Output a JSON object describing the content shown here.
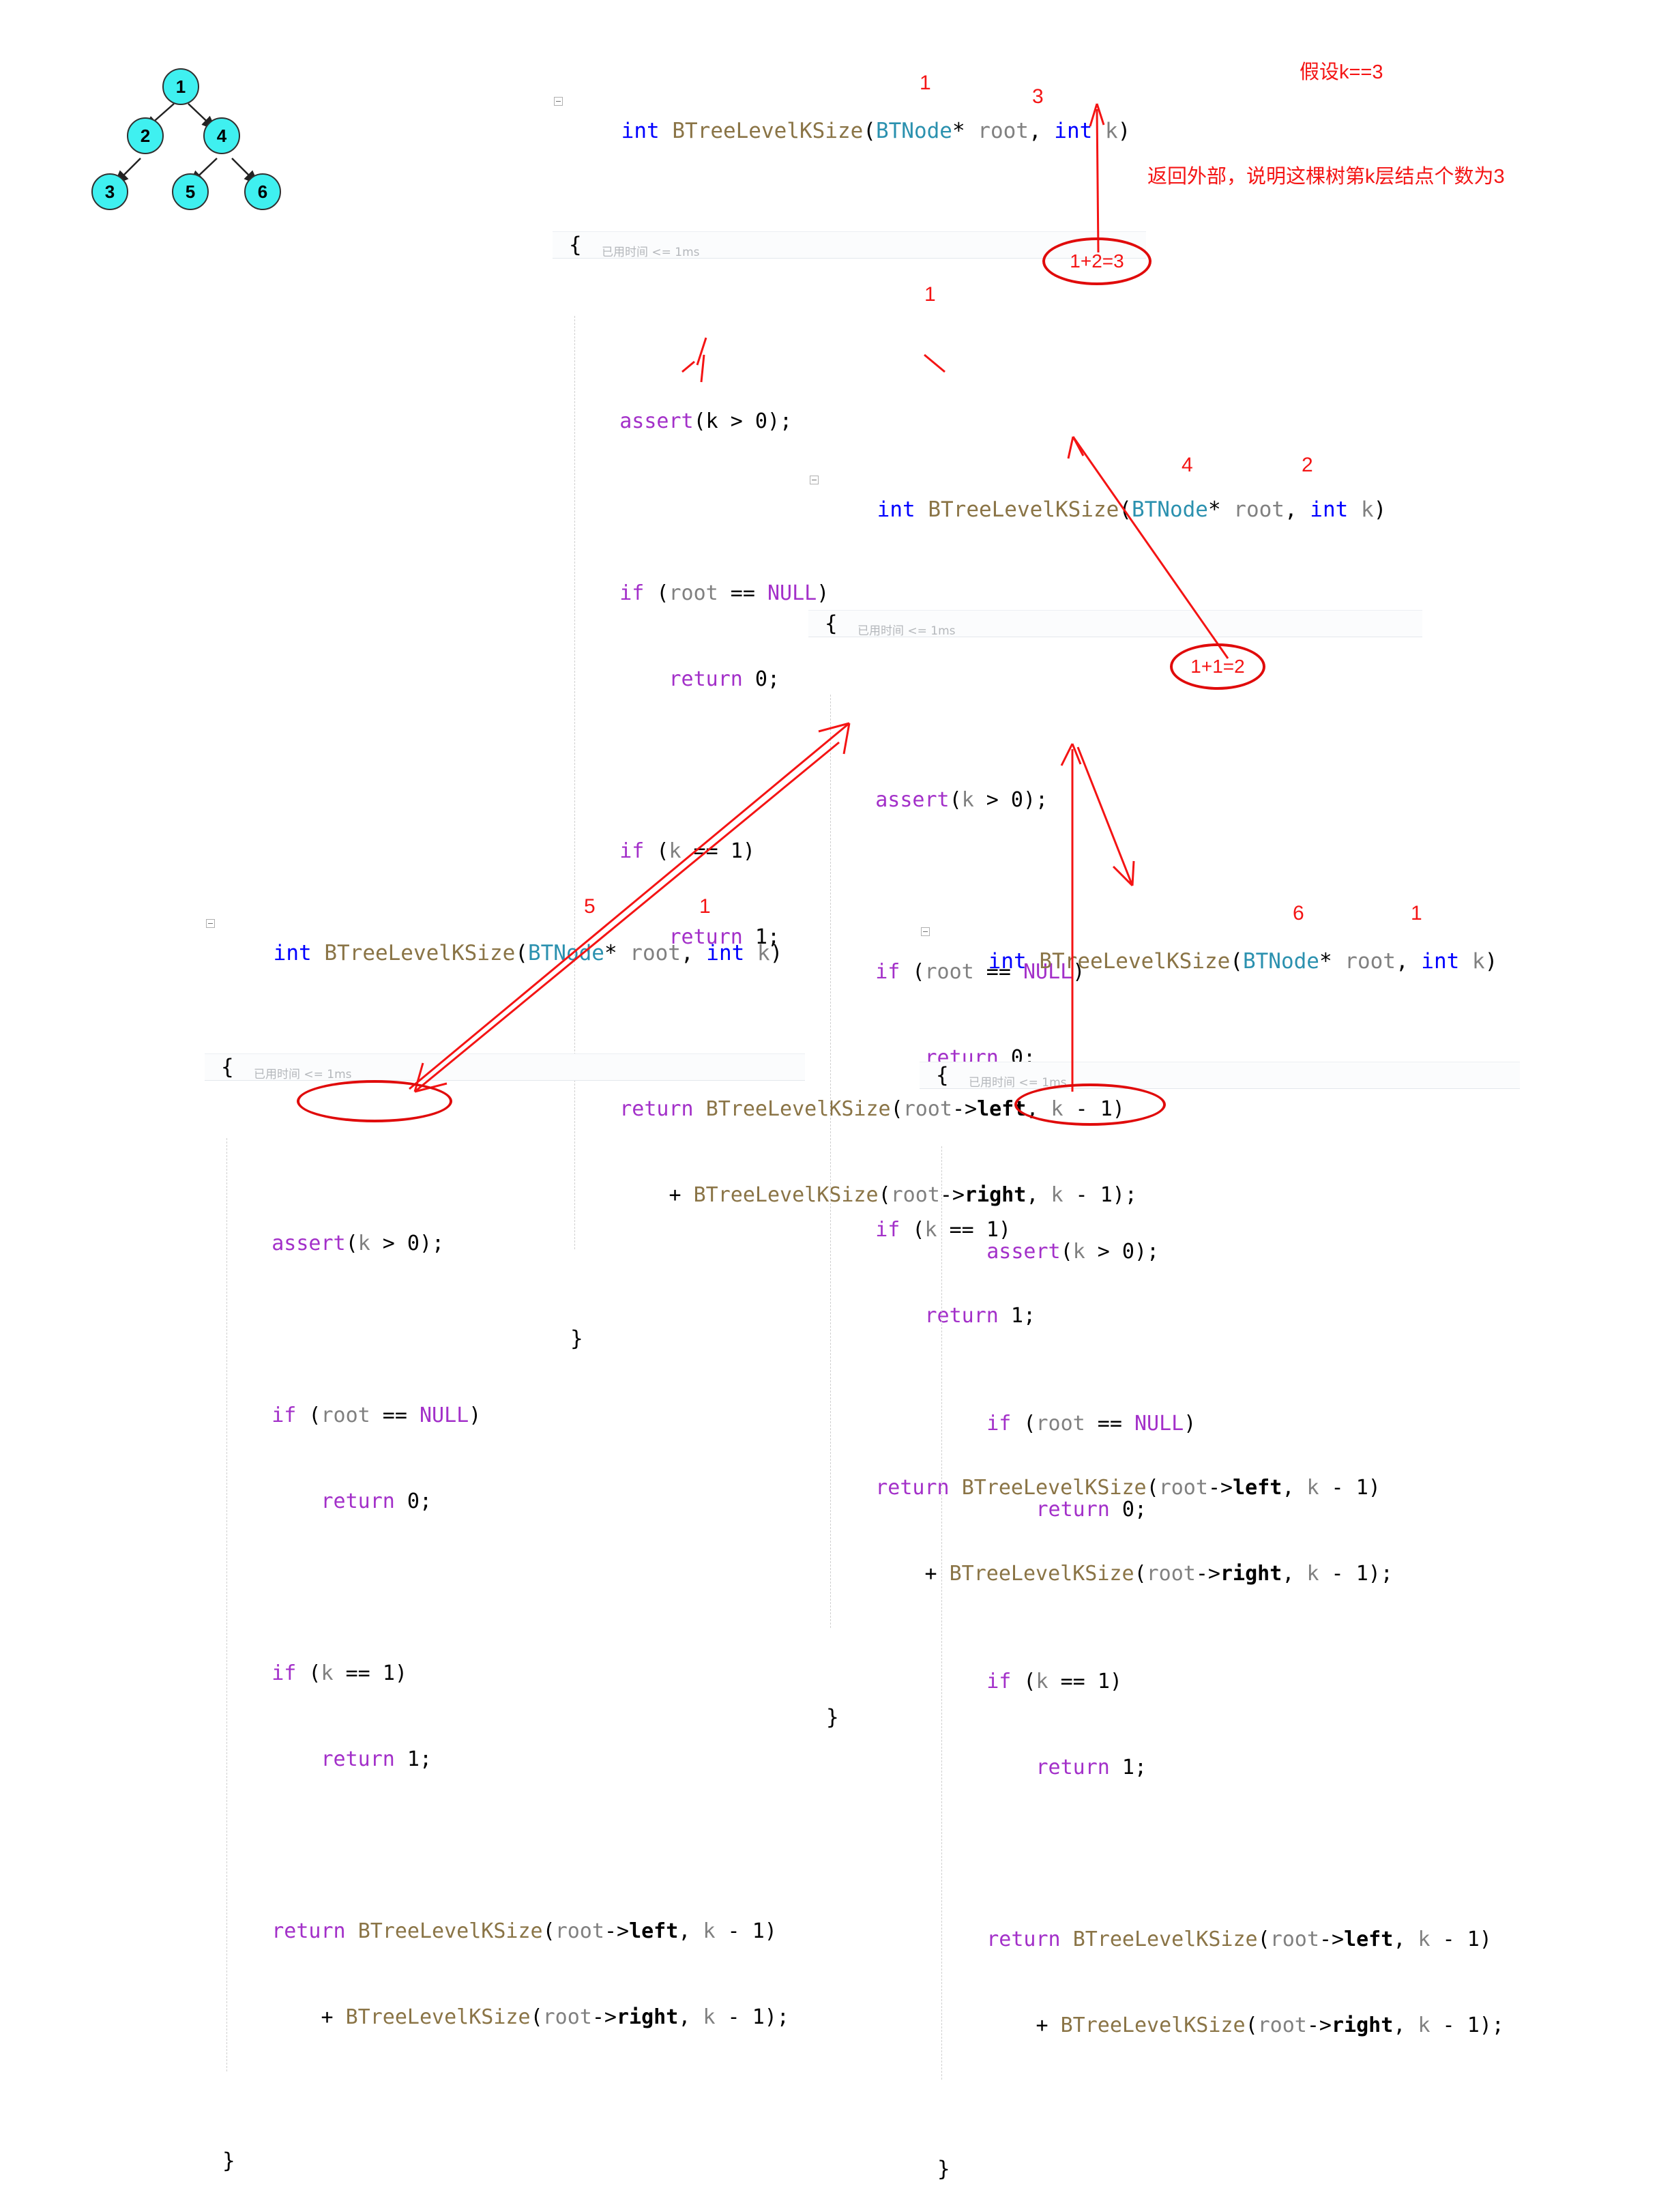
{
  "tree": {
    "label": "binary-tree-diagram",
    "node_fill": "#3ff0f0",
    "nodes": [
      {
        "id": "n1",
        "value": "1"
      },
      {
        "id": "n2",
        "value": "2"
      },
      {
        "id": "n4",
        "value": "4"
      },
      {
        "id": "n3",
        "value": "3"
      },
      {
        "id": "n5",
        "value": "5"
      },
      {
        "id": "n6",
        "value": "6"
      }
    ],
    "edges": [
      [
        "1",
        "2"
      ],
      [
        "1",
        "4"
      ],
      [
        "2",
        "3"
      ],
      [
        "4",
        "5"
      ],
      [
        "4",
        "6"
      ]
    ]
  },
  "code": {
    "signature": {
      "ret_type": "int",
      "name": "BTreeLevelKSize",
      "open_paren": "(",
      "param_type": "BTNode",
      "star": "*",
      "param1": " root",
      "comma": ", ",
      "param2_type": "int",
      "param2": " k",
      "close_paren": ")"
    },
    "codelens": "已用时间 <= 1ms",
    "open_brace": "{",
    "close_brace": "}",
    "lines": {
      "assert": "assert",
      "assert_args": "(k > 0);",
      "if": "if",
      "if_null_cond": " (root == NULL)",
      "return": "return",
      "return_0": " 0;",
      "if_k1_cond": " (k == 1)",
      "return_1": " 1;",
      "rec_left": "BTreeLevelKSize(root->left, k - 1)",
      "rec_right_prefix": "+ ",
      "rec_right": "BTreeLevelKSize(root->right, k - 1);"
    }
  },
  "colors": {
    "annotation_red": "#f41414",
    "circle_red": "#e00b0b",
    "keyword_blue": "#0000ff",
    "function_gold": "#8a7446",
    "type_teal": "#2b91af",
    "identifier_gray": "#808080",
    "control_purple": "#a330c9"
  },
  "annotations": {
    "assume_k": "假设k==3",
    "explanation": "返回外部，说明这棵树第k层结点个数为3",
    "circle_sum_top": "1+2=3",
    "circle_sum_mid": "1+1=2",
    "block1_left_num": "1",
    "block1_right_num": "3",
    "block1_inner_num": "1",
    "block2_left_num": "4",
    "block2_right_num": "2",
    "block3_left_num": "5",
    "block3_right_num": "1",
    "block4_left_num": "6",
    "block4_right_num": "1"
  }
}
